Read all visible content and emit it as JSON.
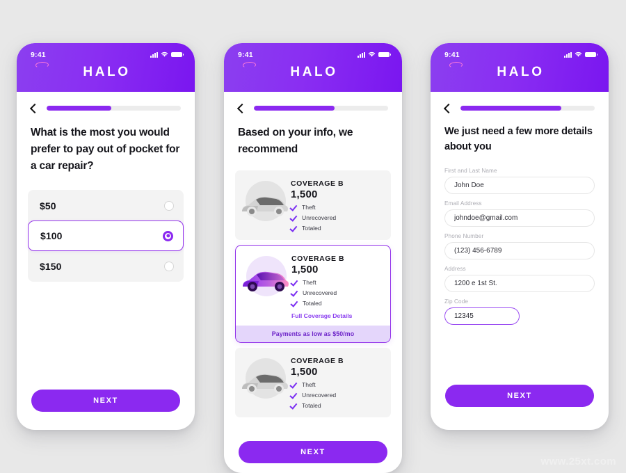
{
  "brand": {
    "name": "HALO",
    "accent": "#8b29f0",
    "accent_light": "#e4d6fb",
    "halo_color": "#ff7ad9"
  },
  "watermark": "www.25xt.com",
  "status_bar": {
    "time": "9:41",
    "icons": [
      "signal-bars-icon",
      "wifi-icon",
      "battery-icon"
    ]
  },
  "screens": [
    {
      "id": "deductible",
      "progress_percent": 48,
      "back_label": "Back",
      "title": "What is the most you would prefer to pay out of pocket for a car repair?",
      "options": [
        {
          "label": "$50",
          "selected": false
        },
        {
          "label": "$100",
          "selected": true
        },
        {
          "label": "$150",
          "selected": false
        }
      ],
      "next_label": "NEXT"
    },
    {
      "id": "recommendation",
      "progress_percent": 60,
      "back_label": "Back",
      "title": "Based on your info, we recommend",
      "cards": [
        {
          "name": "COVERAGE B",
          "price": "1,500",
          "features": [
            "Theft",
            "Unrecovered",
            "Totaled"
          ],
          "active": false
        },
        {
          "name": "COVERAGE B",
          "price": "1,500",
          "features": [
            "Theft",
            "Unrecovered",
            "Totaled"
          ],
          "details_link": "Full Coverage Details",
          "payment_note": "Payments as low as $50/mo",
          "active": true
        },
        {
          "name": "COVERAGE B",
          "price": "1,500",
          "features": [
            "Theft",
            "Unrecovered",
            "Totaled"
          ],
          "active": false
        }
      ],
      "next_label": "NEXT"
    },
    {
      "id": "details",
      "progress_percent": 75,
      "back_label": "Back",
      "title": "We just need a few more details about you",
      "fields": [
        {
          "label": "First and Last Name",
          "value": "John Doe",
          "placeholder": "First and Last Name"
        },
        {
          "label": "Email Address",
          "value": "johndoe@gmail.com",
          "placeholder": "Email Address"
        },
        {
          "label": "Phone Number",
          "value": "(123) 456-6789",
          "placeholder": "Phone Number"
        },
        {
          "label": "Address",
          "value": "1200 e 1st St.",
          "placeholder": "Address"
        },
        {
          "label": "Zip Code",
          "value": "12345",
          "placeholder": "Zip Code",
          "focused": true
        }
      ],
      "next_label": "NEXT"
    }
  ]
}
